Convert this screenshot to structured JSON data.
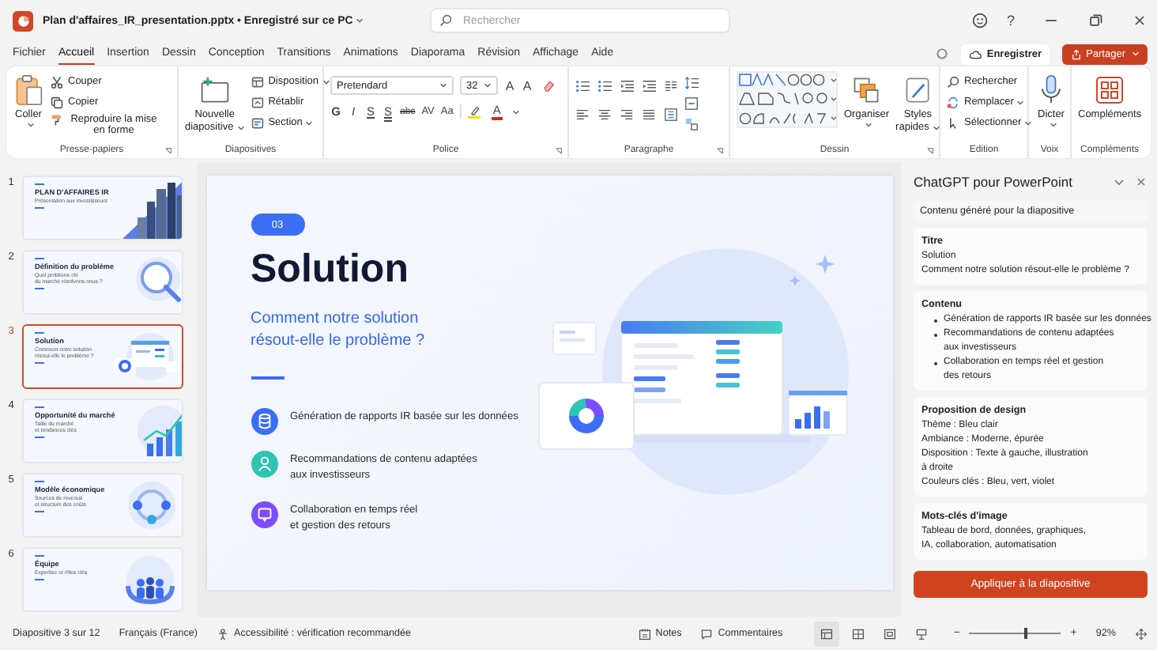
{
  "window": {
    "title": "Plan d'affaires_IR_presentation.pptx • Enregistré sur ce PC"
  },
  "search": {
    "placeholder": "Rechercher"
  },
  "title_controls": {
    "help": "?"
  },
  "menu_tabs": [
    {
      "label": "Fichier",
      "selected": false
    },
    {
      "label": "Accueil",
      "selected": true
    },
    {
      "label": "Insertion",
      "selected": false
    },
    {
      "label": "Dessin",
      "selected": false
    },
    {
      "label": "Conception",
      "selected": false
    },
    {
      "label": "Transitions",
      "selected": false
    },
    {
      "label": "Animations",
      "selected": false
    },
    {
      "label": "Diaporama",
      "selected": false
    },
    {
      "label": "Révision",
      "selected": false
    },
    {
      "label": "Affichage",
      "selected": false
    },
    {
      "label": "Aide",
      "selected": false
    }
  ],
  "header_buttons": {
    "save": "Enregistrer",
    "share": "Partager"
  },
  "ribbon": {
    "clipboard": {
      "label": "Presse-papiers",
      "paste": "Coller",
      "items": [
        "Couper",
        "Copier",
        "Reproduire la mise en forme"
      ]
    },
    "slides": {
      "label": "Diapositives",
      "new_slide": [
        "Nouvelle",
        "diapositive"
      ],
      "items": [
        {
          "label": "Disposition",
          "dropdown": true
        },
        {
          "label": "Rétablir",
          "dropdown": false
        },
        {
          "label": "Section",
          "dropdown": true
        }
      ]
    },
    "font": {
      "label": "Police",
      "font_name": "Pretendard",
      "font_size": "32",
      "size_buttons": [
        "A",
        "A"
      ],
      "format_buttons": [
        "G",
        "I",
        "S",
        "S",
        "abc",
        "AV",
        "Aa"
      ],
      "color_button": "A"
    },
    "paragraph": {
      "label": "Paragraphe"
    },
    "drawing": {
      "label": "Dessin",
      "arrange": "Organiser",
      "quick_styles": [
        "Styles",
        "rapides"
      ]
    },
    "editing": {
      "label": "Edition",
      "items": [
        {
          "label": "Rechercher",
          "dropdown": false
        },
        {
          "label": "Remplacer",
          "dropdown": true
        },
        {
          "label": "Sélectionner",
          "dropdown": true
        }
      ]
    },
    "voice": {
      "label": "Voix",
      "dictate": "Dicter"
    },
    "addins": {
      "label": "Compléments",
      "button": "Compléments"
    }
  },
  "thumbnails": [
    {
      "number": "1",
      "title": "PLAN D'AFFAIRES IR",
      "subtitle_lines": [
        "Présentation aux investisseurs"
      ],
      "kind": "city",
      "selected": false
    },
    {
      "number": "2",
      "title": "Définition du problème",
      "subtitle_lines": [
        "Quel problème clé",
        "du marché résolvons-nous ?"
      ],
      "kind": "magnifier",
      "selected": false
    },
    {
      "number": "3",
      "title": "Solution",
      "subtitle_lines": [
        "Comment notre solution",
        "résout-elle le problème ?"
      ],
      "kind": "dashboard",
      "selected": true
    },
    {
      "number": "4",
      "title": "Opportunité du marché",
      "subtitle_lines": [
        "Taille du marché",
        "et tendances clés"
      ],
      "kind": "chart",
      "selected": false
    },
    {
      "number": "5",
      "title": "Modèle économique",
      "subtitle_lines": [
        "Sources de revenus",
        "et structure des coûts"
      ],
      "kind": "cycle",
      "selected": false
    },
    {
      "number": "6",
      "title": "Équipe",
      "subtitle_lines": [
        "Expertise et rôles clés"
      ],
      "kind": "team",
      "selected": false
    }
  ],
  "slide": {
    "badge": "03",
    "title": "Solution",
    "subtitle_lines": [
      "Comment notre solution",
      "résout-elle le problème ?"
    ],
    "bullets": [
      {
        "lines": [
          "Génération de rapports IR basée sur les données"
        ],
        "color": "#3b6ef5"
      },
      {
        "lines": [
          "Recommandations de contenu adaptées",
          "aux investisseurs"
        ],
        "color": "#2ec4b0"
      },
      {
        "lines": [
          "Collaboration en temps réel",
          "et gestion des retours"
        ],
        "color": "#7b4dff"
      }
    ]
  },
  "assistant": {
    "title": "ChatGPT pour PowerPoint",
    "section": "Contenu généré pour la diapositive",
    "title_card": {
      "heading": "Titre",
      "lines": [
        "Solution",
        "Comment notre solution résout-elle le problème ?"
      ]
    },
    "content_card": {
      "heading": "Contenu",
      "bullets": [
        {
          "lines": [
            "Génération de rapports IR basée sur les données"
          ]
        },
        {
          "lines": [
            "Recommandations de contenu adaptées",
            "aux investisseurs"
          ]
        },
        {
          "lines": [
            "Collaboration en temps réel et gestion",
            "des retours"
          ]
        }
      ]
    },
    "design_card": {
      "heading": "Proposition de design",
      "lines": [
        "Thème : Bleu clair",
        "Ambiance : Moderne, épurée",
        "Disposition : Texte à gauche, illustration",
        "à droite",
        "Couleurs clés : Bleu, vert, violet"
      ]
    },
    "keywords_card": {
      "heading": "Mots-clés d'image",
      "lines": [
        "Tableau de bord, données, graphiques,",
        "IA, collaboration, automatisation"
      ]
    },
    "apply_button": "Appliquer à la diapositive"
  },
  "status_bar": {
    "slide_info": "Diapositive 3 sur 12",
    "language": "Français (France)",
    "accessibility": "Accessibilité : vérification recommandée",
    "notes": "Notes",
    "comments": "Commentaires",
    "views": [
      {
        "selected": true
      },
      {
        "selected": false
      },
      {
        "selected": false
      },
      {
        "selected": false
      }
    ],
    "zoom": {
      "minus": "−",
      "plus": "+",
      "level": 0.6,
      "reading": "92%"
    }
  }
}
